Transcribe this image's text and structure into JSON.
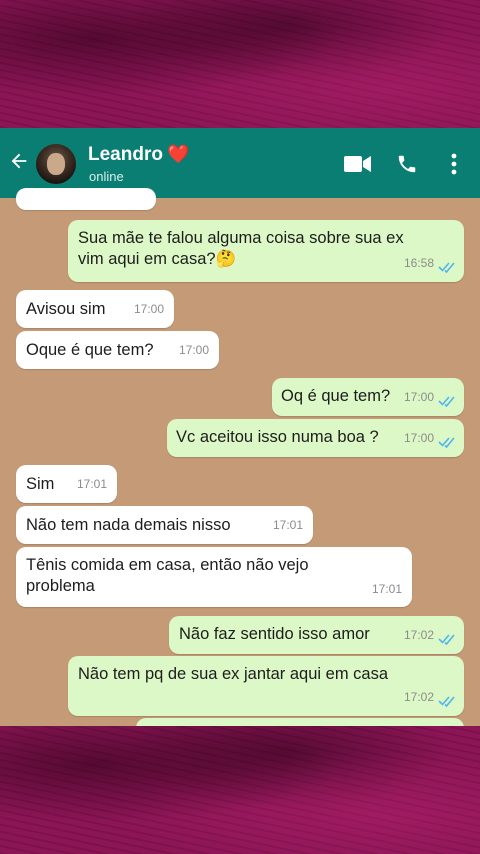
{
  "contact": {
    "name": "Leandro",
    "heart": "❤️",
    "status": "online"
  },
  "icons": {
    "back": "arrow-left-icon",
    "video": "video-call-icon",
    "call": "phone-icon",
    "menu": "more-vertical-icon",
    "read": "double-check-icon"
  },
  "colors": {
    "header": "#0a7e72",
    "outgoing_bubble": "#dcf8c6",
    "incoming_bubble": "#ffffff",
    "chat_background": "#c59a76",
    "read_ticks": "#4fb6ec"
  },
  "messages": [
    {
      "dir": "out",
      "text": "Sua mãe te falou alguma coisa sobre sua ex vim aqui em casa?🤔",
      "time": "16:58",
      "read": true
    },
    {
      "dir": "in",
      "text": "Avisou sim",
      "time": "17:00"
    },
    {
      "dir": "in",
      "text": "Oque é que tem?",
      "time": "17:00"
    },
    {
      "dir": "out",
      "text": "Oq é que tem?",
      "time": "17:00",
      "read": true
    },
    {
      "dir": "out",
      "text": "Vc aceitou isso numa boa ?",
      "time": "17:00",
      "read": true
    },
    {
      "dir": "in",
      "text": "Sim",
      "time": "17:01"
    },
    {
      "dir": "in",
      "text": "Não tem nada demais nisso",
      "time": "17:01"
    },
    {
      "dir": "in",
      "text": "Tênis comida em casa, então não vejo problema",
      "time": "17:01"
    },
    {
      "dir": "out",
      "text": "Não faz sentido isso amor",
      "time": "17:02",
      "read": true
    },
    {
      "dir": "out",
      "text": "Não tem pq de sua ex jantar aqui em casa",
      "time": "17:02",
      "read": true
    }
  ]
}
